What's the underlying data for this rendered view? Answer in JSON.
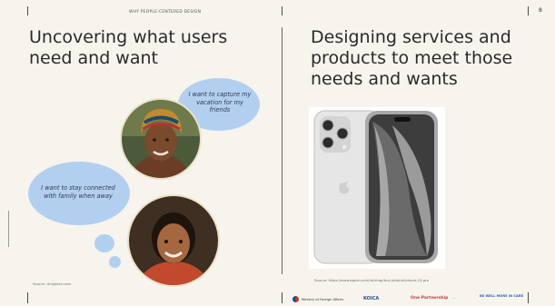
{
  "header": {
    "section_tag": "WHY PEOPLE-CENTERED DESIGN",
    "page_number": "8"
  },
  "left": {
    "title": "Uncovering what users need and want",
    "bubble_1": "I want to capture my vacation for my friends",
    "bubble_2": "I want to stay connected with family when away",
    "source": "Source: Unsplash.com",
    "portrait_1": "woman-with-headwrap-photo",
    "portrait_2": "smiling-girl-photo"
  },
  "right": {
    "title": "Designing services and products to meet those needs and wants",
    "product_image": "smartphone-photo",
    "source": "Source: https://www.apple.com/uk/shop/buy-iphone/iphone-15-pro"
  },
  "footer": {
    "logos": [
      "Ministry of Foreign Affairs",
      "KOICA",
      "One Partnership",
      "—",
      "BE WELL MORE IN CARE"
    ]
  },
  "colors": {
    "background": "#f7f4ee",
    "bubble": "#b3cff0",
    "portrait_ring": "#ece2c6",
    "text": "#2a2a2a"
  }
}
